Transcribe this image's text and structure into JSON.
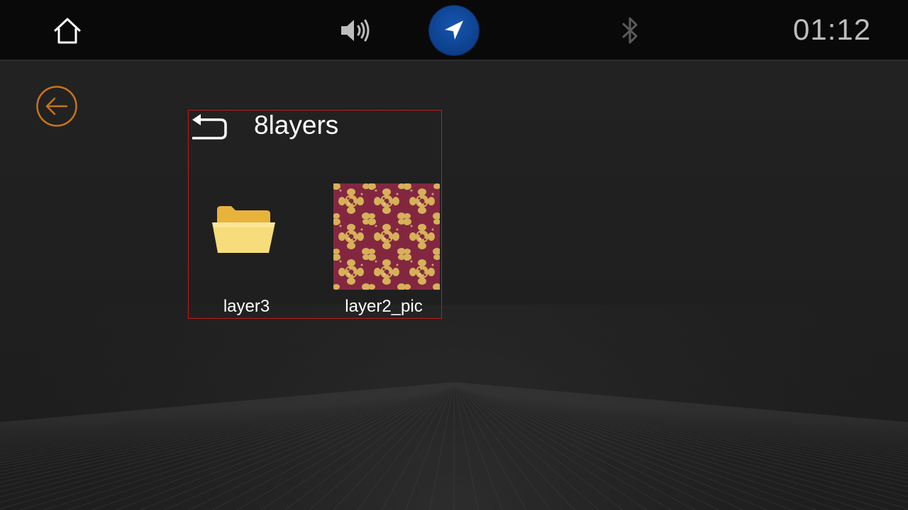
{
  "statusbar": {
    "clock": "01:12",
    "icons": [
      "home-icon",
      "volume-icon",
      "navigation-icon",
      "bluetooth-icon"
    ],
    "nav_button_color": "#0d3f8c"
  },
  "back_button": {
    "icon": "arrow-left-circle-icon",
    "color": "#c8731c"
  },
  "browser": {
    "title": "8layers",
    "up_icon": "return-arrow-icon",
    "frame_color": "#c21a1a",
    "items": [
      {
        "label": "layer3",
        "type": "folder",
        "icon": "folder-icon"
      },
      {
        "label": "layer2_pic",
        "type": "image",
        "icon": "floral-pattern-thumbnail"
      }
    ]
  }
}
